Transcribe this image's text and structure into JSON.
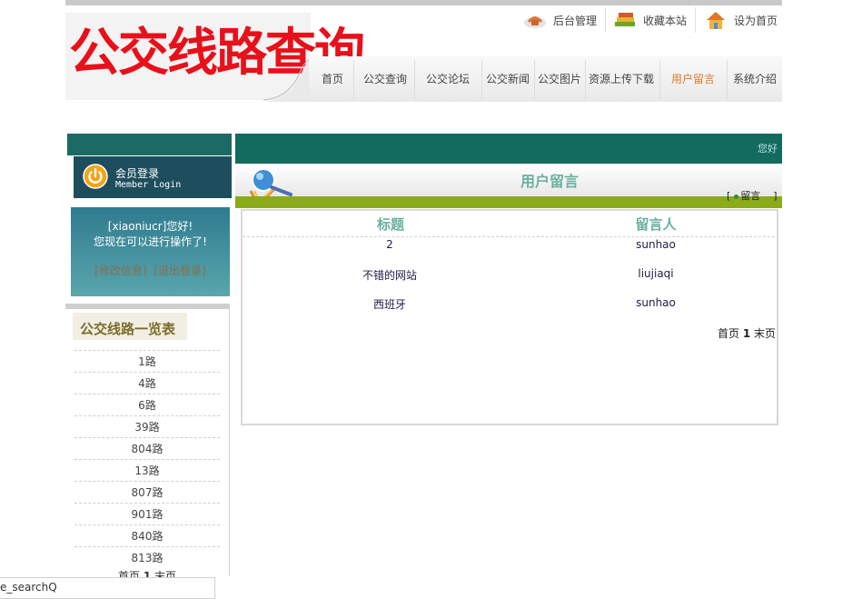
{
  "header": {
    "logo_text": "公交线路查询",
    "quick_links": [
      {
        "label": "后台管理",
        "icon": "phone-icon"
      },
      {
        "label": "收藏本站",
        "icon": "book-stack-icon"
      },
      {
        "label": "设为首页",
        "icon": "house-icon"
      }
    ],
    "nav": [
      {
        "label": "首页",
        "active": false
      },
      {
        "label": "公交查询",
        "active": false
      },
      {
        "label": "公交论坛",
        "active": false
      },
      {
        "label": "公交新闻",
        "active": false
      },
      {
        "label": "公交图片",
        "active": false
      },
      {
        "label": "资源上传下载",
        "active": false
      },
      {
        "label": "用户留言",
        "active": true
      },
      {
        "label": "系统介绍",
        "active": false
      }
    ]
  },
  "login": {
    "title_cn": "会员登录",
    "title_en": "Member Login",
    "welcome_line1": "[xiaoniucr]您好!",
    "welcome_line2": "您现在可以进行操作了!",
    "edit_link": "[修改信息]",
    "logout_link": "[退出登录]"
  },
  "bus_lines": {
    "title": "公交线路一览表",
    "items": [
      "1路",
      "4路",
      "6路",
      "39路",
      "804路",
      "13路",
      "807路",
      "901路",
      "840路",
      "813路"
    ],
    "pager": {
      "first": "首页",
      "page": "1",
      "last": "末页"
    }
  },
  "main": {
    "header_text": "您好",
    "section_title": "用户留言",
    "post_link": "留言",
    "bracket_open": "[",
    "bracket_close": "]",
    "columns": {
      "title": "标题",
      "author": "留言人"
    },
    "rows": [
      {
        "title": "2",
        "author": "sunhao"
      },
      {
        "title": "不错的网站",
        "author": "liujiaqi"
      },
      {
        "title": "西班牙",
        "author": "sunhao"
      }
    ],
    "pager": {
      "first": "首页",
      "page": "1",
      "last": "末页"
    }
  },
  "status_bar": {
    "text": "e_searchQ"
  },
  "colors": {
    "brand_teal": "#136a5f",
    "accent_green": "#8cab1b",
    "logo_red": "#e8101a",
    "active_nav": "#e07a2a",
    "heading_teal": "#6ab0a0"
  }
}
